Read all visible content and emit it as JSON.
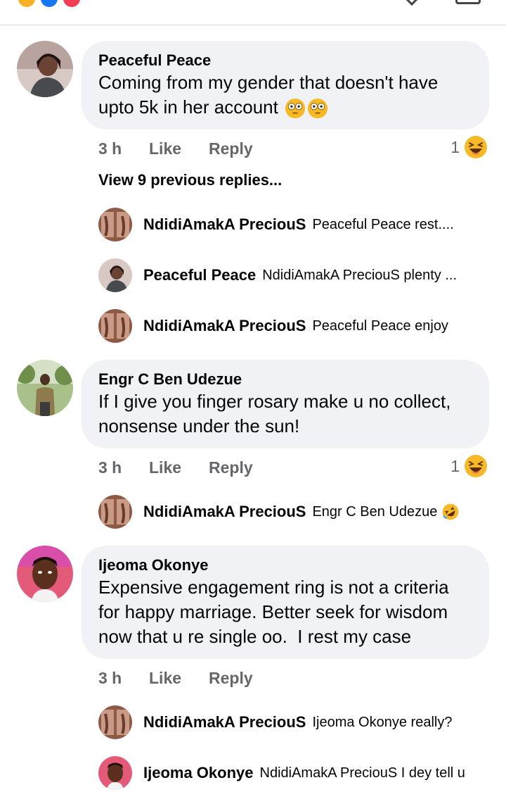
{
  "top_reactions": {
    "colors": [
      "#f7b125",
      "#1877f2",
      "#f33e58"
    ]
  },
  "comments": [
    {
      "author": "Peaceful Peace",
      "text": "Coming from my gender that doesn't have upto 5k in her account",
      "text_line1": "Coming from my gender that doesn't have",
      "text_line2": "upto 5k in her account",
      "trailing_emoji": [
        "flushed-face",
        "flushed-face"
      ],
      "time": "3 h",
      "like_label": "Like",
      "reply_label": "Reply",
      "reaction_count": "1",
      "reaction_icon": "laughing-face",
      "view_previous": "View 9 previous replies...",
      "replies": [
        {
          "author": "NdidiAmakA PreciouS",
          "text": "Peaceful Peace rest...."
        },
        {
          "author": "Peaceful Peace",
          "text": "NdidiAmakA PreciouS plenty ..."
        },
        {
          "author": "NdidiAmakA PreciouS",
          "text": "Peaceful Peace enjoy"
        }
      ]
    },
    {
      "author": "Engr C Ben Udezue",
      "text_line1": "If I give you finger rosary make u no collect,",
      "text_line2": "nonsense under the sun!",
      "time": "3 h",
      "like_label": "Like",
      "reply_label": "Reply",
      "reaction_count": "1",
      "reaction_icon": "laughing-face",
      "replies": [
        {
          "author": "NdidiAmakA PreciouS",
          "text": "Engr C Ben Udezue",
          "trailing_emoji": "rolling-on-floor-laughing"
        }
      ]
    },
    {
      "author": "Ijeoma Okonye",
      "text_line1": "Expensive engagement ring is not a criteria",
      "text_line2": "for happy marriage. Better seek for wisdom",
      "text_line3": "now that u re single oo.  I rest my case",
      "time": "3 h",
      "like_label": "Like",
      "reply_label": "Reply",
      "replies": [
        {
          "author": "NdidiAmakA PreciouS",
          "text": "Ijeoma Okonye really?"
        },
        {
          "author": "Ijeoma Okonye",
          "text": "NdidiAmakA PreciouS I dey tell u"
        }
      ]
    }
  ],
  "colors": {
    "bubble": "#f0f2f5",
    "meta_text": "#65676b",
    "text": "#050505",
    "divider": "#dcdcdc",
    "emoji_yellow": "#f7b928"
  }
}
